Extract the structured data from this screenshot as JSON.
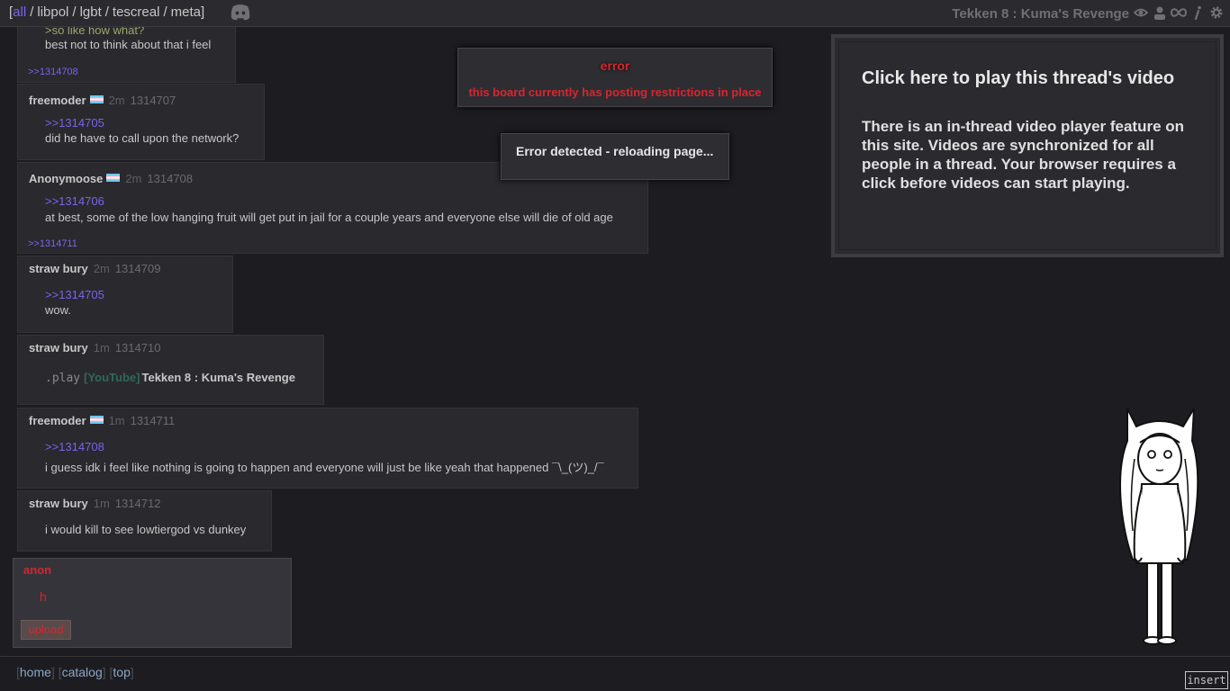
{
  "topbar": {
    "boards": [
      "all",
      "libpol",
      "lgbt",
      "tescreal",
      "meta"
    ],
    "active_board": "all",
    "bracket_open": "[",
    "bracket_close": "]",
    "separator": "/",
    "thread_title": "Tekken 8 : Kuma's Revenge",
    "icons": [
      "discord-icon",
      "eye-icon",
      "user-icon",
      "infinity-icon",
      "info-icon",
      "gear-icon"
    ]
  },
  "posts": [
    {
      "greentext": ">so like how what?",
      "body": "best not to think about that i feel",
      "backlink": ">>1314708"
    },
    {
      "name": "freemoder",
      "flag": "trans-flag",
      "time": "2m",
      "num": "1314707",
      "quote": ">>1314705",
      "body": "did he have to call upon the network?"
    },
    {
      "name": "Anonymoose",
      "flag": "trans-flag",
      "time": "2m",
      "num": "1314708",
      "quote": ">>1314706",
      "body": "at best, some of the low hanging fruit will get put in jail for a couple years and everyone else will die of old age",
      "backlink": ">>1314711"
    },
    {
      "name": "straw bury",
      "time": "2m",
      "num": "1314709",
      "quote": ">>1314705",
      "body": "wow."
    },
    {
      "name": "straw bury",
      "time": "1m",
      "num": "1314710",
      "play_cmd": ".play",
      "yt_tag": "[YouTube]",
      "yt_title": "Tekken 8 : Kuma's Revenge"
    },
    {
      "name": "freemoder",
      "flag": "trans-flag",
      "time": "1m",
      "num": "1314711",
      "quote": ">>1314708",
      "body": "i guess idk i feel like nothing is going to happen and everyone will just be like yeah that happened ¯\\_(ツ)_/¯"
    },
    {
      "name": "straw bury",
      "time": "1m",
      "num": "1314712",
      "body": "i would kill to see lowtiergod vs dunkey"
    }
  ],
  "error_dialog": {
    "title": "error",
    "message": "this board currently has posting restrictions in place"
  },
  "reload_dialog": {
    "message": "Error detected - reloading page..."
  },
  "video_panel": {
    "heading": "Click here to play this thread's video",
    "description": "There is an in-thread video player feature on this site. Videos are synchronized for all people in a thread. Your browser requires a click before videos can start playing."
  },
  "reply_form": {
    "name": "anon",
    "text": "h",
    "upload_label": "upload"
  },
  "footer": {
    "links": [
      "home",
      "catalog",
      "top"
    ]
  },
  "mode_indicator": "insert",
  "colors": {
    "background": "#1d1d21",
    "post_bg": "#29292e",
    "link": "#7d63e8",
    "error": "#d7262f",
    "greentext": "#9aa86a"
  }
}
